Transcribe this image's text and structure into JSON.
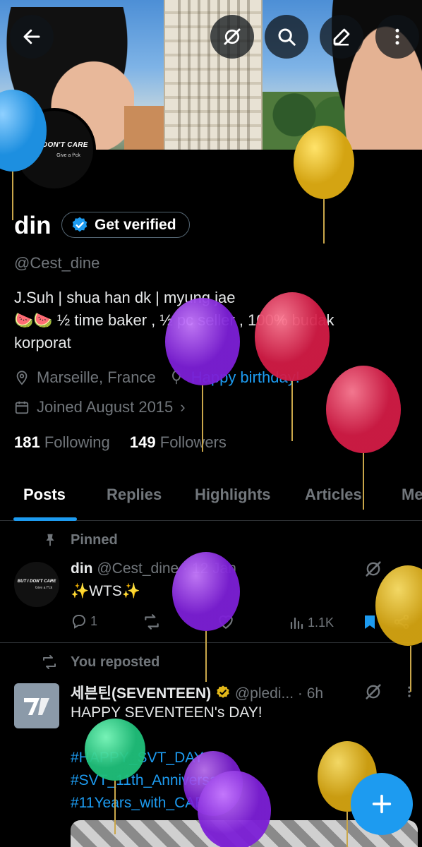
{
  "profile": {
    "name": "din",
    "verify_label": "Get verified",
    "handle": "@Cest_dine",
    "avatar_text": "BUT I DON'T CARE",
    "avatar_sub": "Give a f*ck",
    "bio_line1": "J.Suh | shua han dk | myung jae",
    "bio_line2": "🍉🍉 ½ time baker , ½ pc seller , 100% budak",
    "bio_line3": "korporat",
    "location": "Marseille, France",
    "birthday": "Happy birthday!",
    "joined": "Joined August 2015",
    "following_count": "181",
    "following_label": "Following",
    "followers_count": "149",
    "followers_label": "Followers"
  },
  "tabs": [
    "Posts",
    "Replies",
    "Highlights",
    "Articles",
    "Me"
  ],
  "pinned_post": {
    "pinned_label": "Pinned",
    "author": "din",
    "handle_time": "@Cest_dine · 12 Jan",
    "text": "✨WTS✨",
    "replies": "1",
    "views": "1.1K"
  },
  "repost": {
    "repost_label": "You reposted",
    "author": "세븐틴(SEVENTEEN)",
    "handle_time": "@pledi... · 6h",
    "text": "HAPPY SEVENTEEN's DAY!",
    "hashtags": [
      "#HAPPY_SVT_DAY",
      "#SVT_11th_Anniversary",
      "#11Years_with_CARAT"
    ]
  },
  "icons": [
    "back-arrow-icon",
    "grok-icon",
    "search-icon",
    "edit-icon",
    "more-vertical-icon",
    "verified-badge-icon",
    "location-pin-icon",
    "balloon-icon",
    "calendar-icon",
    "pin-icon",
    "reply-icon",
    "retweet-icon",
    "like-icon",
    "views-icon",
    "bookmark-icon",
    "share-icon",
    "plus-icon"
  ],
  "colors": {
    "accent": "#1d9bf0",
    "background": "#000000",
    "muted": "#71767b",
    "gold_badge": "#e2b719"
  }
}
